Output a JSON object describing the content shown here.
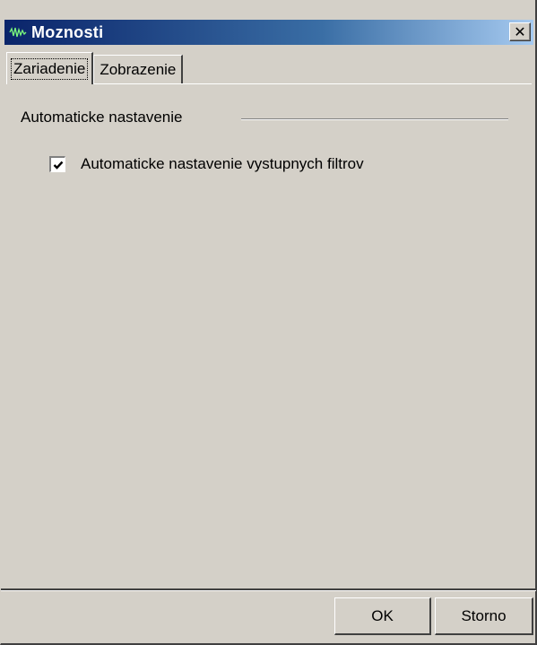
{
  "window": {
    "title": "Moznosti",
    "close_symbol": "✕",
    "title_icon": "waveform-icon"
  },
  "tabs": [
    {
      "label": "Zariadenie",
      "active": true
    },
    {
      "label": "Zobrazenie",
      "active": false
    }
  ],
  "group": {
    "label": "Automaticke nastavenie",
    "checkbox": {
      "label": "Automaticke nastavenie vystupnych filtrov",
      "checked": true
    }
  },
  "buttons": {
    "ok": "OK",
    "cancel": "Storno"
  },
  "colors": {
    "face": "#d4d0c8",
    "title_start": "#0a246a",
    "title_end": "#a6caf0"
  }
}
